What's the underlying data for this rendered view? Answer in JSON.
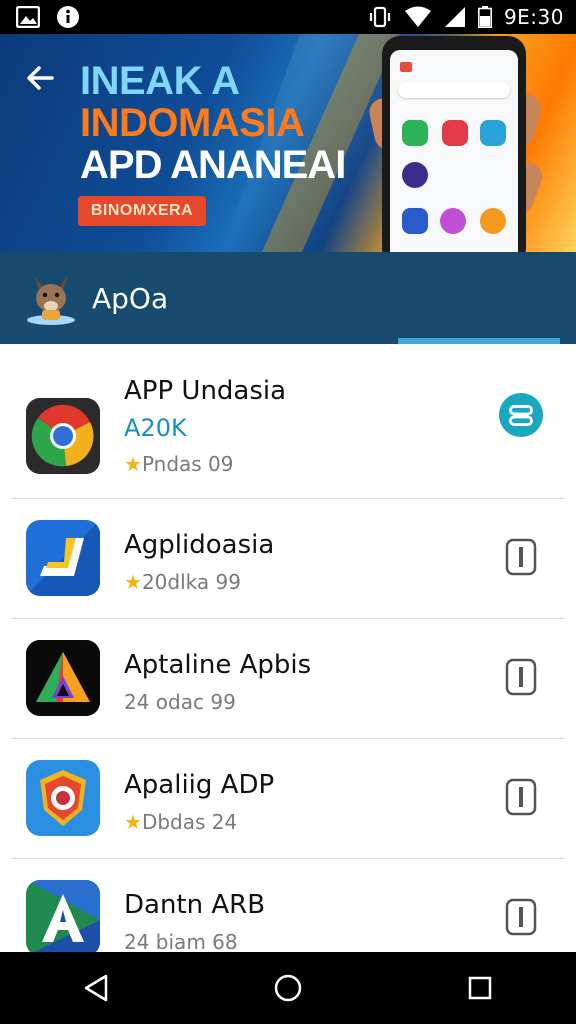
{
  "status_bar": {
    "time": "9E:30",
    "left_icons": [
      "gallery-icon",
      "info-icon"
    ],
    "right_icons": [
      "vibrate-icon",
      "wifi-icon",
      "signal-icon",
      "battery-icon"
    ]
  },
  "banner": {
    "back_icon": "back-arrow-icon",
    "line1": "INEAK A",
    "line2": "INDOMASIA",
    "line3": "APD ANANEAI",
    "badge": "BINOMXERA"
  },
  "section": {
    "title": "ApOa",
    "logo_icon": "mascot-logo-icon"
  },
  "apps": [
    {
      "icon": "chrome-like-icon",
      "title": "APP Undasia",
      "subtitle": "A20K",
      "rating": "Pndas 09",
      "has_star": true,
      "action_icon": "install-toggle-icon"
    },
    {
      "icon": "blue-yellow-app-icon",
      "title": "Agplidoasia",
      "subtitle": "",
      "rating": "20dlka 99",
      "has_star": true,
      "action_icon": "download-outline-icon"
    },
    {
      "icon": "rainbow-triangle-app-icon",
      "title": "Aptaline Apbis",
      "subtitle": "",
      "rating": "24 odac 99",
      "has_star": false,
      "action_icon": "download-outline-icon"
    },
    {
      "icon": "shield-app-icon",
      "title": "Apaliig ADP",
      "subtitle": "",
      "rating": "Dbdas 24",
      "has_star": true,
      "action_icon": "download-outline-icon"
    },
    {
      "icon": "letter-a-app-icon",
      "title": "Dantn ARB",
      "subtitle": "",
      "rating": "24 biam 68",
      "has_star": false,
      "action_icon": "download-outline-icon"
    }
  ],
  "nav_bar": {
    "back": "nav-back-icon",
    "home": "nav-home-icon",
    "recents": "nav-recents-icon"
  },
  "colors": {
    "section_bg": "#164a6f",
    "accent": "#1b8fbf",
    "star": "#f5b21a"
  }
}
